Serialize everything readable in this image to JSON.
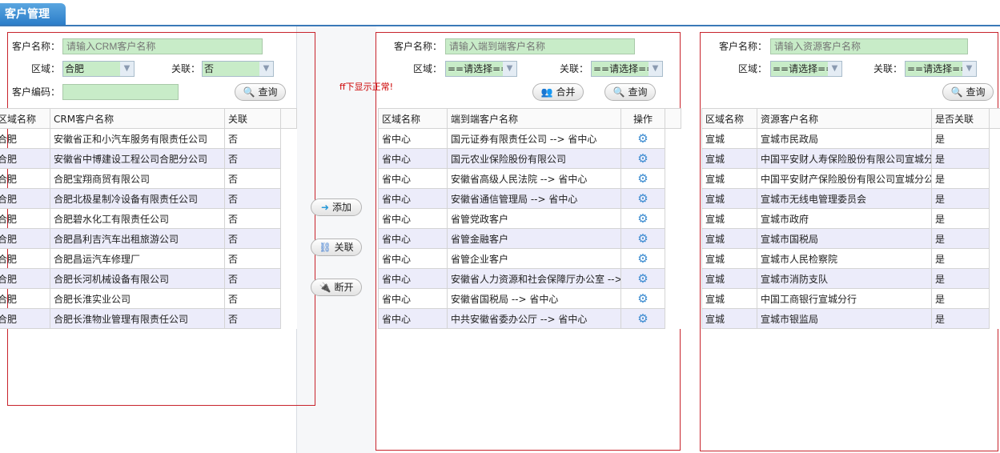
{
  "tab": {
    "title": "客户管理"
  },
  "note": "ff下显示正常!",
  "crm": {
    "name_label": "客户名称：",
    "name_placeholder": "请输入CRM客户名称",
    "region_label": "区域：",
    "region_value": "合肥",
    "link_label": "关联：",
    "link_value": "否",
    "code_label": "客户编码：",
    "code_value": "",
    "search": "查询",
    "columns": [
      "区域名称",
      "CRM客户名称",
      "关联"
    ],
    "rows": [
      [
        "合肥",
        "安徽省正和小汽车服务有限责任公司",
        "否"
      ],
      [
        "合肥",
        "安徽省中博建设工程公司合肥分公司",
        "否"
      ],
      [
        "合肥",
        "合肥宝翔商贸有限公司",
        "否"
      ],
      [
        "合肥",
        "合肥北极星制冷设备有限责任公司",
        "否"
      ],
      [
        "合肥",
        "合肥碧水化工有限责任公司",
        "否"
      ],
      [
        "合肥",
        "合肥昌利吉汽车出租旅游公司",
        "否"
      ],
      [
        "合肥",
        "合肥昌运汽车修理厂",
        "否"
      ],
      [
        "合肥",
        "合肥长河机械设备有限公司",
        "否"
      ],
      [
        "合肥",
        "合肥长淮实业公司",
        "否"
      ],
      [
        "合肥",
        "合肥长淮物业管理有限责任公司",
        "否"
      ]
    ]
  },
  "actions": {
    "add": "添加",
    "link": "关联",
    "unlink": "断开"
  },
  "e2e": {
    "name_label": "客户名称：",
    "name_placeholder": "请输入端到端客户名称",
    "region_label": "区域：",
    "region_value": "==请选择==",
    "link_label": "关联：",
    "link_value": "==请选择==",
    "merge": "合并",
    "search": "查询",
    "columns": [
      "区域名称",
      "端到端客户名称",
      "操作"
    ],
    "rows": [
      [
        "省中心",
        "国元证券有限责任公司 --> 省中心"
      ],
      [
        "省中心",
        "国元农业保险股份有限公司"
      ],
      [
        "省中心",
        "安徽省高级人民法院 --> 省中心"
      ],
      [
        "省中心",
        "安徽省通信管理局 --> 省中心"
      ],
      [
        "省中心",
        "省管党政客户"
      ],
      [
        "省中心",
        "省管金融客户"
      ],
      [
        "省中心",
        "省管企业客户"
      ],
      [
        "省中心",
        "安徽省人力资源和社会保障厅办公室 -->"
      ],
      [
        "省中心",
        "安徽省国税局 --> 省中心"
      ],
      [
        "省中心",
        "中共安徽省委办公厅 --> 省中心"
      ]
    ]
  },
  "res": {
    "name_label": "客户名称：",
    "name_placeholder": "请输入资源客户名称",
    "region_label": "区域：",
    "region_value": "==请选择==",
    "link_label": "关联：",
    "link_value": "==请选择==",
    "search": "查询",
    "columns": [
      "区域名称",
      "资源客户名称",
      "是否关联"
    ],
    "rows": [
      [
        "宣城",
        "宣城市民政局",
        "是"
      ],
      [
        "宣城",
        "中国平安财人寿保险股份有限公司宣城分",
        "是"
      ],
      [
        "宣城",
        "中国平安财产保险股份有限公司宣城分公",
        "是"
      ],
      [
        "宣城",
        "宣城市无线电管理委员会",
        "是"
      ],
      [
        "宣城",
        "宣城市政府",
        "是"
      ],
      [
        "宣城",
        "宣城市国税局",
        "是"
      ],
      [
        "宣城",
        "宣城市人民检察院",
        "是"
      ],
      [
        "宣城",
        "宣城市消防支队",
        "是"
      ],
      [
        "宣城",
        "中国工商银行宣城分行",
        "是"
      ],
      [
        "宣城",
        "宣城市银监局",
        "是"
      ]
    ]
  }
}
